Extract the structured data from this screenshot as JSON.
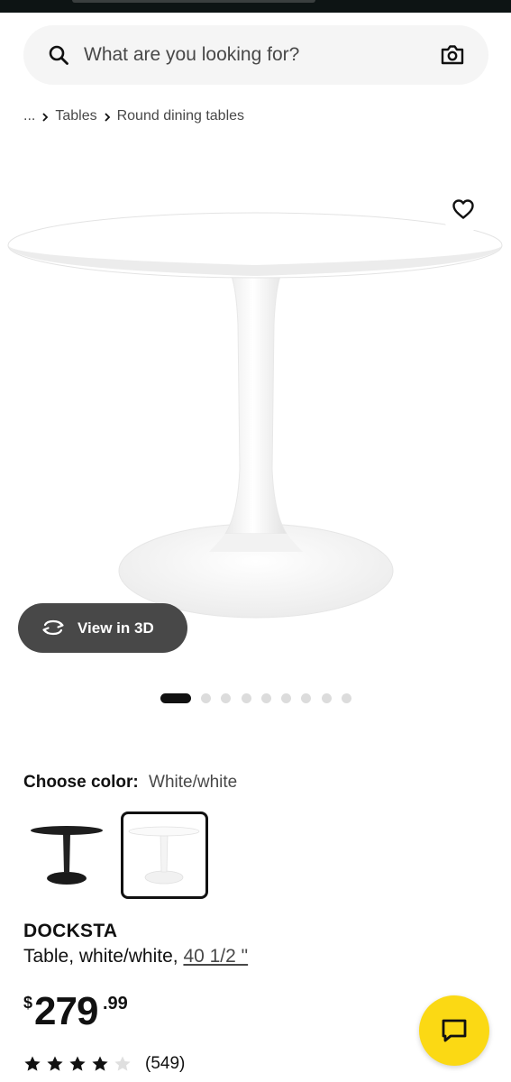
{
  "search": {
    "placeholder": "What are you looking for?",
    "search_icon": "search-icon",
    "camera_icon": "camera-icon"
  },
  "breadcrumb": {
    "items": [
      "...",
      "Tables",
      "Round dining tables"
    ]
  },
  "gallery": {
    "view_3d_label": "View in 3D",
    "dot_count": 10,
    "active_index": 0
  },
  "color": {
    "label": "Choose color:",
    "value": "White/white",
    "options": [
      "black",
      "white"
    ],
    "selected": "white"
  },
  "product": {
    "name": "DOCKSTA",
    "description": "Table, white/white,",
    "size_link": "40 1/2 \""
  },
  "price": {
    "currency": "$",
    "dollars": "279",
    "cents": ".99"
  },
  "rating": {
    "stars": 4,
    "max": 5,
    "count": "(549)"
  },
  "colors": {
    "accent_yellow": "#fbd914",
    "dark_button": "#484848",
    "text_primary": "#111111",
    "search_bg": "#f5f5f5"
  },
  "icons": {
    "favorite": "heart-icon",
    "view_3d": "rotate-3d-icon",
    "chat": "chat-bubble-icon"
  }
}
